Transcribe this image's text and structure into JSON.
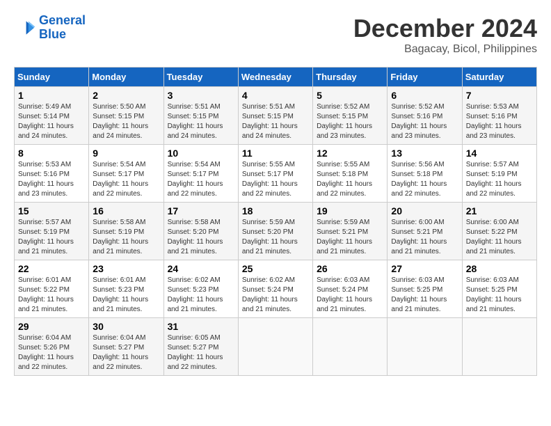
{
  "logo": {
    "line1": "General",
    "line2": "Blue"
  },
  "title": {
    "month": "December 2024",
    "location": "Bagacay, Bicol, Philippines"
  },
  "headers": [
    "Sunday",
    "Monday",
    "Tuesday",
    "Wednesday",
    "Thursday",
    "Friday",
    "Saturday"
  ],
  "weeks": [
    [
      {
        "day": "1",
        "sunrise": "5:49 AM",
        "sunset": "5:14 PM",
        "daylight": "11 hours and 24 minutes."
      },
      {
        "day": "2",
        "sunrise": "5:50 AM",
        "sunset": "5:15 PM",
        "daylight": "11 hours and 24 minutes."
      },
      {
        "day": "3",
        "sunrise": "5:51 AM",
        "sunset": "5:15 PM",
        "daylight": "11 hours and 24 minutes."
      },
      {
        "day": "4",
        "sunrise": "5:51 AM",
        "sunset": "5:15 PM",
        "daylight": "11 hours and 24 minutes."
      },
      {
        "day": "5",
        "sunrise": "5:52 AM",
        "sunset": "5:15 PM",
        "daylight": "11 hours and 23 minutes."
      },
      {
        "day": "6",
        "sunrise": "5:52 AM",
        "sunset": "5:16 PM",
        "daylight": "11 hours and 23 minutes."
      },
      {
        "day": "7",
        "sunrise": "5:53 AM",
        "sunset": "5:16 PM",
        "daylight": "11 hours and 23 minutes."
      }
    ],
    [
      {
        "day": "8",
        "sunrise": "5:53 AM",
        "sunset": "5:16 PM",
        "daylight": "11 hours and 23 minutes."
      },
      {
        "day": "9",
        "sunrise": "5:54 AM",
        "sunset": "5:17 PM",
        "daylight": "11 hours and 22 minutes."
      },
      {
        "day": "10",
        "sunrise": "5:54 AM",
        "sunset": "5:17 PM",
        "daylight": "11 hours and 22 minutes."
      },
      {
        "day": "11",
        "sunrise": "5:55 AM",
        "sunset": "5:17 PM",
        "daylight": "11 hours and 22 minutes."
      },
      {
        "day": "12",
        "sunrise": "5:55 AM",
        "sunset": "5:18 PM",
        "daylight": "11 hours and 22 minutes."
      },
      {
        "day": "13",
        "sunrise": "5:56 AM",
        "sunset": "5:18 PM",
        "daylight": "11 hours and 22 minutes."
      },
      {
        "day": "14",
        "sunrise": "5:57 AM",
        "sunset": "5:19 PM",
        "daylight": "11 hours and 22 minutes."
      }
    ],
    [
      {
        "day": "15",
        "sunrise": "5:57 AM",
        "sunset": "5:19 PM",
        "daylight": "11 hours and 21 minutes."
      },
      {
        "day": "16",
        "sunrise": "5:58 AM",
        "sunset": "5:19 PM",
        "daylight": "11 hours and 21 minutes."
      },
      {
        "day": "17",
        "sunrise": "5:58 AM",
        "sunset": "5:20 PM",
        "daylight": "11 hours and 21 minutes."
      },
      {
        "day": "18",
        "sunrise": "5:59 AM",
        "sunset": "5:20 PM",
        "daylight": "11 hours and 21 minutes."
      },
      {
        "day": "19",
        "sunrise": "5:59 AM",
        "sunset": "5:21 PM",
        "daylight": "11 hours and 21 minutes."
      },
      {
        "day": "20",
        "sunrise": "6:00 AM",
        "sunset": "5:21 PM",
        "daylight": "11 hours and 21 minutes."
      },
      {
        "day": "21",
        "sunrise": "6:00 AM",
        "sunset": "5:22 PM",
        "daylight": "11 hours and 21 minutes."
      }
    ],
    [
      {
        "day": "22",
        "sunrise": "6:01 AM",
        "sunset": "5:22 PM",
        "daylight": "11 hours and 21 minutes."
      },
      {
        "day": "23",
        "sunrise": "6:01 AM",
        "sunset": "5:23 PM",
        "daylight": "11 hours and 21 minutes."
      },
      {
        "day": "24",
        "sunrise": "6:02 AM",
        "sunset": "5:23 PM",
        "daylight": "11 hours and 21 minutes."
      },
      {
        "day": "25",
        "sunrise": "6:02 AM",
        "sunset": "5:24 PM",
        "daylight": "11 hours and 21 minutes."
      },
      {
        "day": "26",
        "sunrise": "6:03 AM",
        "sunset": "5:24 PM",
        "daylight": "11 hours and 21 minutes."
      },
      {
        "day": "27",
        "sunrise": "6:03 AM",
        "sunset": "5:25 PM",
        "daylight": "11 hours and 21 minutes."
      },
      {
        "day": "28",
        "sunrise": "6:03 AM",
        "sunset": "5:25 PM",
        "daylight": "11 hours and 21 minutes."
      }
    ],
    [
      {
        "day": "29",
        "sunrise": "6:04 AM",
        "sunset": "5:26 PM",
        "daylight": "11 hours and 22 minutes."
      },
      {
        "day": "30",
        "sunrise": "6:04 AM",
        "sunset": "5:27 PM",
        "daylight": "11 hours and 22 minutes."
      },
      {
        "day": "31",
        "sunrise": "6:05 AM",
        "sunset": "5:27 PM",
        "daylight": "11 hours and 22 minutes."
      },
      null,
      null,
      null,
      null
    ]
  ]
}
